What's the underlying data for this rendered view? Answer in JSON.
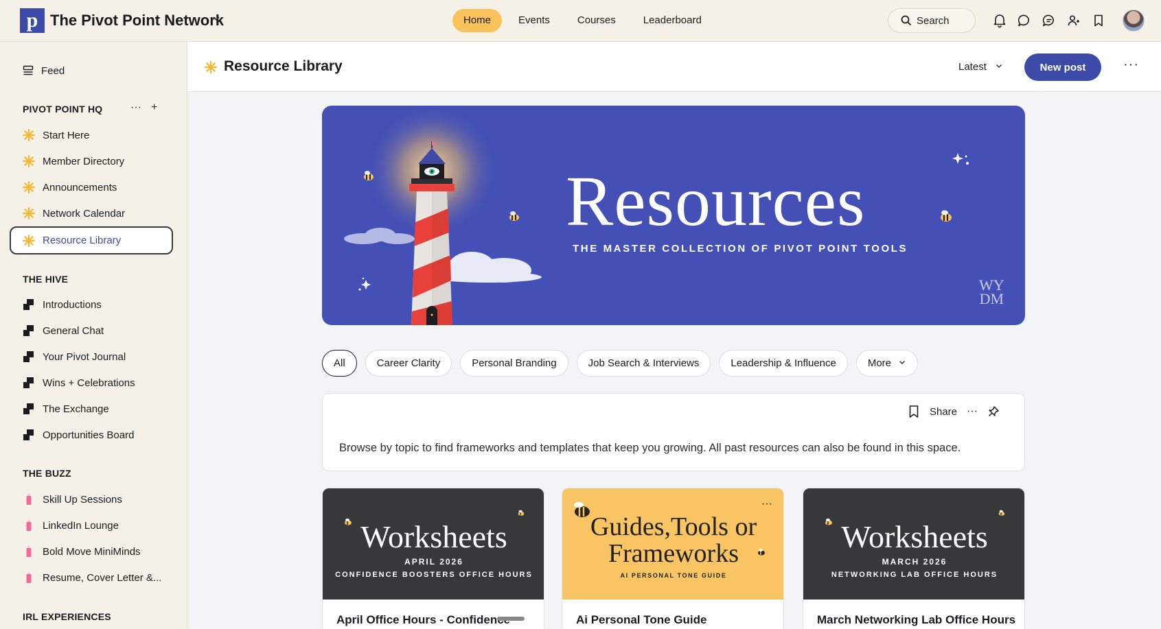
{
  "topbar": {
    "brand_logo_letter": "p",
    "brand_name": "The Pivot Point Network",
    "nav": [
      {
        "label": "Home",
        "active": true
      },
      {
        "label": "Events",
        "active": false
      },
      {
        "label": "Courses",
        "active": false
      },
      {
        "label": "Leaderboard",
        "active": false
      }
    ],
    "search_label": "Search",
    "icons": [
      "bell-icon",
      "chat-bubble-icon",
      "messages-icon",
      "people-icon",
      "bookmark-icon"
    ]
  },
  "sidebar": {
    "feed_label": "Feed",
    "sections": [
      {
        "title": "PIVOT POINT HQ",
        "icon": "sun-icon",
        "items": [
          "Start Here",
          "Member Directory",
          "Announcements",
          "Network Calendar",
          "Resource Library"
        ]
      },
      {
        "title": "THE HIVE",
        "icon": "blocks-icon",
        "items": [
          "Introductions",
          "General Chat",
          "Your Pivot Journal",
          "Wins + Celebrations",
          "The Exchange",
          "Opportunities Board"
        ]
      },
      {
        "title": "THE BUZZ",
        "icon": "pencil-icon",
        "items": [
          "Skill Up Sessions",
          "LinkedIn Lounge",
          "Bold Move MiniMinds",
          "Resume, Cover Letter &..."
        ]
      },
      {
        "title": "IRL EXPERIENCES",
        "items": []
      }
    ],
    "active_item": "Resource Library"
  },
  "main": {
    "title": "Resource Library",
    "sort_label": "Latest",
    "new_post_label": "New post",
    "banner": {
      "title": "Resources",
      "subtitle": "THE MASTER COLLECTION OF PIVOT POINT TOOLS",
      "mark_line1": "WY",
      "mark_line2": "DM"
    },
    "filters": [
      "All",
      "Career Clarity",
      "Personal Branding",
      "Job Search & Interviews",
      "Leadership & Influence",
      "More"
    ],
    "post": {
      "share_label": "Share",
      "body": "Browse by topic to find frameworks and templates that keep you growing. All past resources can also be found in this space."
    },
    "cards": [
      {
        "cover_title": "Worksheets",
        "cover_line1": "APRIL 2026",
        "cover_line2": "CONFIDENCE BOOSTERS OFFICE HOURS",
        "title": "April Office Hours - Confidence"
      },
      {
        "cover_title_line1": "Guides,Tools or",
        "cover_title_line2": "Frameworks",
        "cover_line1": "AI PERSONAL TONE GUIDE",
        "title": "Ai Personal Tone Guide"
      },
      {
        "cover_title": "Worksheets",
        "cover_line1": "MARCH 2026",
        "cover_line2": "NETWORKING LAB OFFICE HOURS",
        "title": "March Networking Lab Office Hours"
      }
    ],
    "colors": {
      "accent": "#3c4aa8",
      "home_pill": "#f9c25b",
      "sidebar_bg": "#f5f1e8",
      "banner_bg": "#4450b5"
    }
  }
}
